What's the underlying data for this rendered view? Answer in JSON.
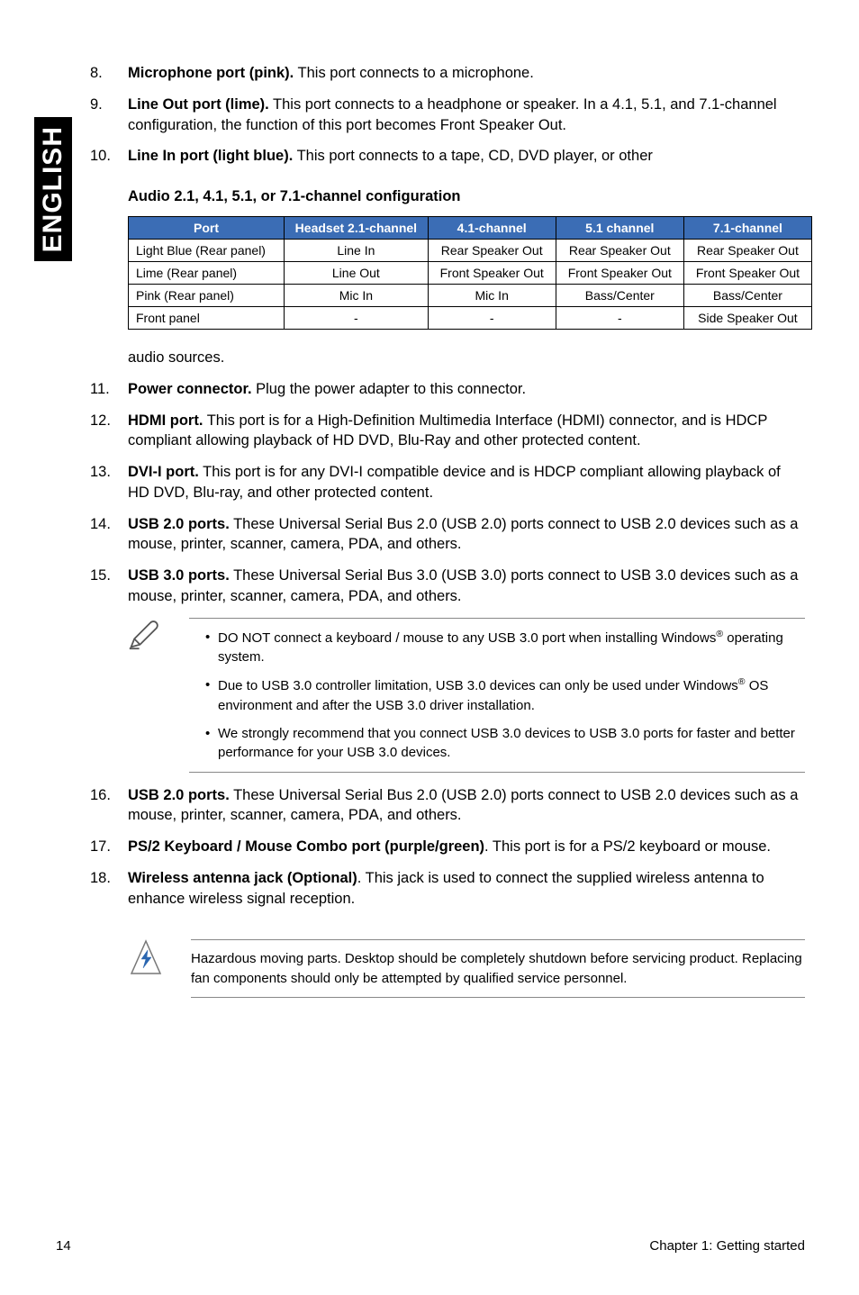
{
  "lang_tab": "ENGLISH",
  "list": {
    "i8": {
      "n": "8.",
      "b1": "Microphone port (pink).",
      "t1": " This port connects to a microphone."
    },
    "i9": {
      "n": "9.",
      "b1": "Line Out port (lime).",
      "t1": " This port connects to a headphone or speaker. In a 4.1, 5.1, and 7.1-channel configuration, the function of this port becomes Front Speaker Out."
    },
    "i10": {
      "n": "10.",
      "b1": "Line In port (light blue).",
      "t1": " This port connects to a tape, CD, DVD player, or other"
    },
    "audio_heading": "Audio 2.1, 4.1, 5.1, or 7.1-channel configuration",
    "after_table": "audio sources.",
    "i11": {
      "n": "11.",
      "b1": "Power connector.",
      "t1": " Plug the power adapter to this connector."
    },
    "i12": {
      "n": "12.",
      "b1": "HDMI port.",
      "t1": " This port is for a High-Definition Multimedia Interface (HDMI) connector, and is HDCP compliant allowing playback of HD DVD, Blu-Ray and other protected content."
    },
    "i13": {
      "n": "13.",
      "b1": "DVI-I port.",
      "t1": " This port is for any DVI-I compatible device and is HDCP compliant allowing playback of HD DVD, Blu-ray, and other protected content."
    },
    "i14": {
      "n": "14.",
      "b1": "USB 2.0 ports.",
      "t1": " These Universal Serial Bus 2.0 (USB 2.0) ports connect to USB 2.0 devices such as a mouse, printer, scanner, camera, PDA, and others."
    },
    "i15": {
      "n": "15.",
      "b1": "USB 3.0 ports.",
      "t1": " These Universal Serial Bus 3.0 (USB 3.0) ports connect to USB 3.0 devices such as a mouse, printer, scanner, camera, PDA, and others."
    },
    "i16": {
      "n": "16.",
      "b1": "USB 2.0 ports.",
      "t1": " These Universal Serial Bus 2.0 (USB 2.0) ports connect to USB 2.0 devices such as a mouse, printer, scanner, camera, PDA, and others."
    },
    "i17": {
      "n": "17.",
      "b1": "PS/2 Keyboard / Mouse Combo port (purple/green)",
      "t1": ". This port is for a PS/2 keyboard or mouse."
    },
    "i18": {
      "n": "18.",
      "b1": "Wireless antenna jack (Optional)",
      "t1": ". This jack is used to connect the supplied wireless antenna to enhance wireless signal reception."
    }
  },
  "table": {
    "headers": [
      "Port",
      "Headset 2.1-channel",
      "4.1-channel",
      "5.1 channel",
      "7.1-channel"
    ],
    "rows": [
      [
        "Light Blue (Rear panel)",
        "Line In",
        "Rear Speaker Out",
        "Rear Speaker Out",
        "Rear Speaker Out"
      ],
      [
        "Lime (Rear panel)",
        "Line Out",
        "Front Speaker Out",
        "Front Speaker Out",
        "Front Speaker Out"
      ],
      [
        "Pink (Rear panel)",
        "Mic In",
        "Mic In",
        "Bass/Center",
        "Bass/Center"
      ],
      [
        "Front panel",
        "-",
        "-",
        "-",
        "Side Speaker Out"
      ]
    ]
  },
  "notes": {
    "n1a": "DO NOT connect a keyboard / mouse to any USB 3.0 port when installing Windows",
    "n1b": " operating system.",
    "n2a": "Due to USB 3.0 controller limitation, USB 3.0 devices can only be used under Windows",
    "n2b": " OS environment and after the USB 3.0 driver installation.",
    "n3": "We strongly recommend that you connect USB 3.0 devices to USB 3.0 ports for faster and better performance for your USB 3.0 devices."
  },
  "warning": "Hazardous moving parts. Desktop should be completely shutdown before servicing product. Replacing fan components should only be attempted by qualified service personnel.",
  "footer": {
    "page": "14",
    "chapter": "Chapter 1: Getting started"
  }
}
